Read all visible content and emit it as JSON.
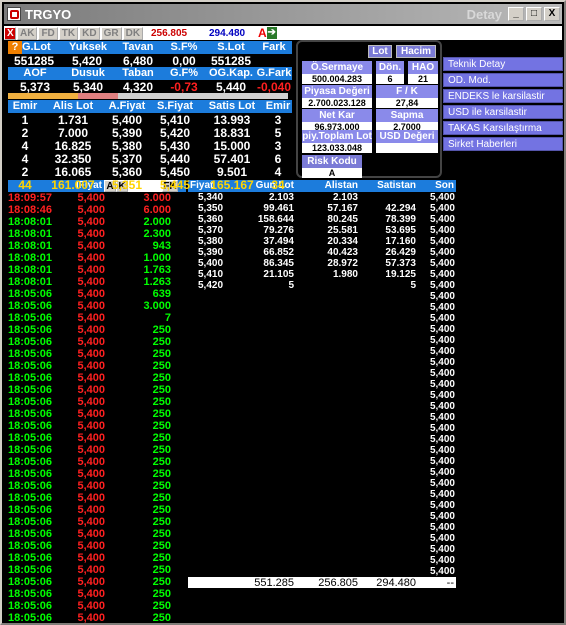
{
  "window": {
    "title": "TRGYO",
    "subtitle": "Detay",
    "min_label": "_",
    "max_label": "□",
    "close_label": "X"
  },
  "toolbar": {
    "buttons": [
      "AK",
      "FD",
      "TK",
      "KD",
      "GR",
      "DK"
    ],
    "value_red": "256.805",
    "value_blue": "294.480",
    "a_label": "A",
    "close_label": "X"
  },
  "summary1": {
    "help_label": "?",
    "headers": [
      "G.Lot",
      "Yuksek",
      "Tavan",
      "S.F%",
      "S.Lot",
      "Fark"
    ],
    "values": [
      "551285",
      "5,420",
      "6,480",
      "0,00",
      "551285",
      ""
    ]
  },
  "summary2": {
    "headers": [
      "AOF",
      "Dusuk",
      "Taban",
      "G.F%",
      "OG.Kap.",
      "G.Fark"
    ],
    "values": [
      "5,373",
      "5,340",
      "4,320",
      "-0,73",
      "5,440",
      "-0,040"
    ]
  },
  "depth": {
    "headers": [
      "Emir",
      "Alis Lot",
      "A.Fiyat",
      "S.Fiyat",
      "Satis Lot",
      "Emir"
    ],
    "rows": [
      [
        "1",
        "1.731",
        "5,400",
        "5,410",
        "13.993",
        "3"
      ],
      [
        "2",
        "7.000",
        "5,390",
        "5,420",
        "18.831",
        "5"
      ],
      [
        "4",
        "16.825",
        "5,380",
        "5,430",
        "15.000",
        "3"
      ],
      [
        "4",
        "32.350",
        "5,370",
        "5,440",
        "57.401",
        "6"
      ],
      [
        "2",
        "16.065",
        "5,360",
        "5,450",
        "9.501",
        "4"
      ]
    ],
    "total": [
      "44",
      "161.007",
      "5,351",
      "5,445",
      "165.167",
      "34"
    ]
  },
  "panel": {
    "tabs": [
      "Lot",
      "Hacim"
    ],
    "fields": [
      {
        "label": "Ö.Sermaye",
        "value": "500.004.283"
      },
      {
        "label": "Dön.",
        "value": "6"
      },
      {
        "label": "HAO",
        "value": "21"
      },
      {
        "label": "Piyasa Değeri",
        "value": "2.700.023.128"
      },
      {
        "label": "F / K",
        "value": "27,84"
      },
      {
        "label": "Net Kar",
        "value": "96.973.000"
      },
      {
        "label": "Sapma",
        "value": "2,7000"
      },
      {
        "label": "piy.Toplam Lot",
        "value": "123.033.048"
      },
      {
        "label": "USD Değeri",
        "value": ""
      },
      {
        "label": "Risk Kodu",
        "value": "A"
      }
    ]
  },
  "right_menu": [
    "Teknik Detay",
    "OD. Mod.",
    "ENDEKS le karsilastir",
    "USD ile karsilastir",
    "TAKAS Karsılaştırma",
    "Sirket Haberleri"
  ],
  "trades": {
    "header_label": "IFiyat",
    "controls": [
      "A",
      "K",
      "FK"
    ],
    "rows": [
      [
        "18:09:57",
        "5,400",
        "3.000",
        "r"
      ],
      [
        "18:08:46",
        "5,400",
        "6.000",
        "r"
      ],
      [
        "18:08:01",
        "5,400",
        "2.000",
        "g"
      ],
      [
        "18:08:01",
        "5,400",
        "2.300",
        "g"
      ],
      [
        "18:08:01",
        "5,400",
        "943",
        "g"
      ],
      [
        "18:08:01",
        "5,400",
        "1.000",
        "g"
      ],
      [
        "18:08:01",
        "5,400",
        "1.763",
        "g"
      ],
      [
        "18:08:01",
        "5,400",
        "1.263",
        "g"
      ],
      [
        "18:05:06",
        "5,400",
        "639",
        "g"
      ],
      [
        "18:05:06",
        "5,400",
        "3.000",
        "g"
      ],
      [
        "18:05:06",
        "5,400",
        "7",
        "g"
      ],
      [
        "18:05:06",
        "5,400",
        "250",
        "g"
      ],
      [
        "18:05:06",
        "5,400",
        "250",
        "g"
      ],
      [
        "18:05:06",
        "5,400",
        "250",
        "g"
      ],
      [
        "18:05:06",
        "5,400",
        "250",
        "g"
      ],
      [
        "18:05:06",
        "5,400",
        "250",
        "g"
      ],
      [
        "18:05:06",
        "5,400",
        "250",
        "g"
      ],
      [
        "18:05:06",
        "5,400",
        "250",
        "g"
      ],
      [
        "18:05:06",
        "5,400",
        "250",
        "g"
      ],
      [
        "18:05:06",
        "5,400",
        "250",
        "g"
      ],
      [
        "18:05:06",
        "5,400",
        "250",
        "g"
      ],
      [
        "18:05:06",
        "5,400",
        "250",
        "g"
      ],
      [
        "18:05:06",
        "5,400",
        "250",
        "g"
      ],
      [
        "18:05:06",
        "5,400",
        "250",
        "g"
      ],
      [
        "18:05:06",
        "5,400",
        "250",
        "g"
      ],
      [
        "18:05:06",
        "5,400",
        "250",
        "g"
      ],
      [
        "18:05:06",
        "5,400",
        "250",
        "g"
      ],
      [
        "18:05:06",
        "5,400",
        "250",
        "g"
      ],
      [
        "18:05:06",
        "5,400",
        "250",
        "g"
      ],
      [
        "18:05:06",
        "5,400",
        "250",
        "g"
      ],
      [
        "18:05:06",
        "5,400",
        "250",
        "g"
      ],
      [
        "18:05:06",
        "5,400",
        "250",
        "g"
      ],
      [
        "18:05:06",
        "5,400",
        "250",
        "g"
      ],
      [
        "18:05:06",
        "5,400",
        "250",
        "g"
      ],
      [
        "18:05:06",
        "5,400",
        "250",
        "g"
      ],
      [
        "18:05:06",
        "5,400",
        "250",
        "g"
      ]
    ]
  },
  "levels": {
    "headers": [
      "Fiyat",
      "Gun Lot",
      "Alistan",
      "Satistan",
      "Son"
    ],
    "rows": [
      [
        "5,340",
        "2.103",
        "2.103",
        ""
      ],
      [
        "5,350",
        "99.461",
        "57.167",
        "42.294"
      ],
      [
        "5,360",
        "158.644",
        "80.245",
        "78.399"
      ],
      [
        "5,370",
        "79.276",
        "25.581",
        "53.695"
      ],
      [
        "5,380",
        "37.494",
        "20.334",
        "17.160"
      ],
      [
        "5,390",
        "66.852",
        "40.423",
        "26.429"
      ],
      [
        "5,400",
        "86.345",
        "28.972",
        "57.373"
      ],
      [
        "5,410",
        "21.105",
        "1.980",
        "19.125"
      ],
      [
        "5,420",
        "5",
        "",
        "5"
      ]
    ],
    "total": [
      "551.285",
      "256.805",
      "294.480",
      "--"
    ]
  },
  "son_values": [
    "5,400",
    "5,400",
    "5,400",
    "5,400",
    "5,400",
    "5,400",
    "5,400",
    "5,400",
    "5,400",
    "5,400",
    "5,400",
    "5,400",
    "5,400",
    "5,400",
    "5,400",
    "5,400",
    "5,400",
    "5,400",
    "5,400",
    "5,400",
    "5,400",
    "5,400",
    "5,400",
    "5,400",
    "5,400",
    "5,400",
    "5,400",
    "5,400",
    "5,400",
    "5,400",
    "5,400",
    "5,400",
    "5,400",
    "5,400",
    "5,400"
  ]
}
